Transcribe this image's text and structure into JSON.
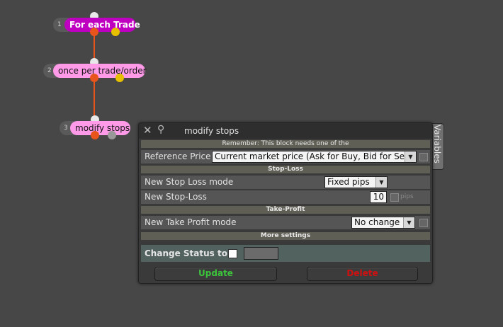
{
  "nodes": [
    {
      "num": "1",
      "label": "For each Trade",
      "bg": "#c000c0",
      "fg": "#ffffff"
    },
    {
      "num": "2",
      "label": "once per trade/order",
      "bg": "#ff9ae8",
      "fg": "#111111"
    },
    {
      "num": "3",
      "label": "modify stops",
      "bg": "#ff9ae8",
      "fg": "#111111"
    }
  ],
  "panel": {
    "title": "modify stops",
    "side_tab": "Variables",
    "note": "Remember: This block needs one of the",
    "reference_price_label": "Reference Price",
    "reference_price_value": "Current market price (Ask for Buy, Bid for Sell)",
    "section_stop_loss": "Stop-Loss",
    "stop_loss_mode_label": "New Stop Loss mode",
    "stop_loss_mode_value": "Fixed pips",
    "stop_loss_label": "New Stop-Loss",
    "stop_loss_value": "10",
    "stop_loss_unit": "pips",
    "section_take_profit": "Take-Profit",
    "take_profit_mode_label": "New Take Profit mode",
    "take_profit_mode_value": "No change",
    "more_settings": "More settings",
    "change_status_label": "Change Status to",
    "update_label": "Update",
    "delete_label": "Delete"
  },
  "colors": {
    "update": "#3cc43c",
    "delete": "#d01010",
    "link": "#e8551c"
  }
}
